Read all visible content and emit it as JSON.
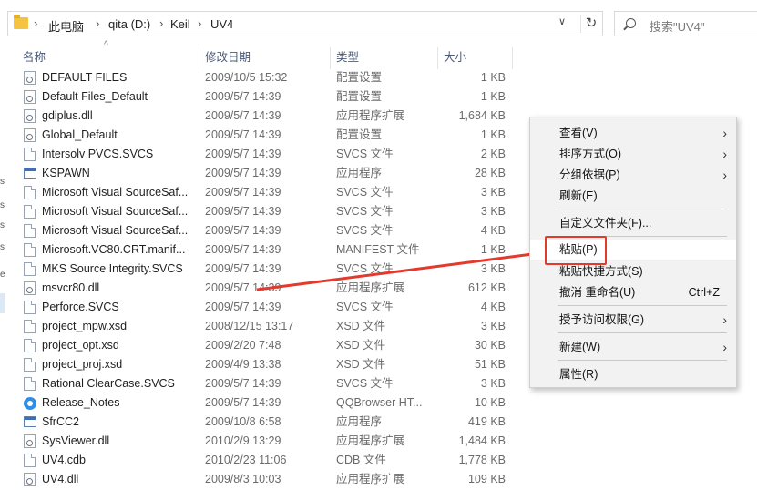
{
  "address_bar": {
    "crumbs": [
      "此电脑",
      "qita (D:)",
      "Keil",
      "UV4"
    ],
    "separator": "›",
    "dropdown": "∨",
    "refresh": "↻"
  },
  "search": {
    "placeholder": "搜索\"UV4\""
  },
  "columns": {
    "name": "名称",
    "date": "修改日期",
    "type": "类型",
    "size": "大小"
  },
  "nav_stub_letters": [
    "s",
    "s",
    "s",
    "s",
    "e"
  ],
  "files": [
    {
      "name": "DEFAULT FILES",
      "date": "2009/10/5 15:32",
      "type": "配置设置",
      "size": "1 KB",
      "icon": "settings-file-icon"
    },
    {
      "name": "Default Files_Default",
      "date": "2009/5/7 14:39",
      "type": "配置设置",
      "size": "1 KB",
      "icon": "settings-file-icon"
    },
    {
      "name": "gdiplus.dll",
      "date": "2009/5/7 14:39",
      "type": "应用程序扩展",
      "size": "1,684 KB",
      "icon": "dll-file-icon"
    },
    {
      "name": "Global_Default",
      "date": "2009/5/7 14:39",
      "type": "配置设置",
      "size": "1 KB",
      "icon": "settings-file-icon"
    },
    {
      "name": "Intersolv PVCS.SVCS",
      "date": "2009/5/7 14:39",
      "type": "SVCS 文件",
      "size": "2 KB",
      "icon": "file-icon"
    },
    {
      "name": "KSPAWN",
      "date": "2009/5/7 14:39",
      "type": "应用程序",
      "size": "28 KB",
      "icon": "application-icon"
    },
    {
      "name": "Microsoft Visual SourceSaf...",
      "date": "2009/5/7 14:39",
      "type": "SVCS 文件",
      "size": "3 KB",
      "icon": "file-icon"
    },
    {
      "name": "Microsoft Visual SourceSaf...",
      "date": "2009/5/7 14:39",
      "type": "SVCS 文件",
      "size": "3 KB",
      "icon": "file-icon"
    },
    {
      "name": "Microsoft Visual SourceSaf...",
      "date": "2009/5/7 14:39",
      "type": "SVCS 文件",
      "size": "4 KB",
      "icon": "file-icon"
    },
    {
      "name": "Microsoft.VC80.CRT.manif...",
      "date": "2009/5/7 14:39",
      "type": "MANIFEST 文件",
      "size": "1 KB",
      "icon": "file-icon"
    },
    {
      "name": "MKS Source Integrity.SVCS",
      "date": "2009/5/7 14:39",
      "type": "SVCS 文件",
      "size": "3 KB",
      "icon": "file-icon"
    },
    {
      "name": "msvcr80.dll",
      "date": "2009/5/7 14:39",
      "type": "应用程序扩展",
      "size": "612 KB",
      "icon": "dll-file-icon"
    },
    {
      "name": "Perforce.SVCS",
      "date": "2009/5/7 14:39",
      "type": "SVCS 文件",
      "size": "4 KB",
      "icon": "file-icon"
    },
    {
      "name": "project_mpw.xsd",
      "date": "2008/12/15 13:17",
      "type": "XSD 文件",
      "size": "3 KB",
      "icon": "file-icon"
    },
    {
      "name": "project_opt.xsd",
      "date": "2009/2/20 7:48",
      "type": "XSD 文件",
      "size": "30 KB",
      "icon": "file-icon"
    },
    {
      "name": "project_proj.xsd",
      "date": "2009/4/9 13:38",
      "type": "XSD 文件",
      "size": "51 KB",
      "icon": "file-icon"
    },
    {
      "name": "Rational ClearCase.SVCS",
      "date": "2009/5/7 14:39",
      "type": "SVCS 文件",
      "size": "3 KB",
      "icon": "file-icon"
    },
    {
      "name": "Release_Notes",
      "date": "2009/5/7 14:39",
      "type": "QQBrowser HT...",
      "size": "10 KB",
      "icon": "qqbrowser-icon"
    },
    {
      "name": "SfrCC2",
      "date": "2009/10/8 6:58",
      "type": "应用程序",
      "size": "419 KB",
      "icon": "application-icon"
    },
    {
      "name": "SysViewer.dll",
      "date": "2010/2/9 13:29",
      "type": "应用程序扩展",
      "size": "1,484 KB",
      "icon": "dll-file-icon"
    },
    {
      "name": "UV4.cdb",
      "date": "2010/2/23 11:06",
      "type": "CDB 文件",
      "size": "1,778 KB",
      "icon": "file-icon"
    },
    {
      "name": "UV4.dll",
      "date": "2009/8/3 10:03",
      "type": "应用程序扩展",
      "size": "109 KB",
      "icon": "dll-file-icon"
    }
  ],
  "context_menu": {
    "view": "查看(V)",
    "sort_by": "排序方式(O)",
    "group_by": "分组依据(P)",
    "refresh": "刷新(E)",
    "customize_folder": "自定义文件夹(F)...",
    "paste": "粘贴(P)",
    "paste_shortcut": "粘贴快捷方式(S)",
    "undo_rename": "撤消 重命名(U)",
    "undo_shortcut": "Ctrl+Z",
    "give_access": "授予访问权限(G)",
    "new": "新建(W)",
    "properties": "属性(R)",
    "submenu_arrow": "›"
  },
  "annotation": {
    "color": "#e23a2d",
    "target": "paste"
  }
}
